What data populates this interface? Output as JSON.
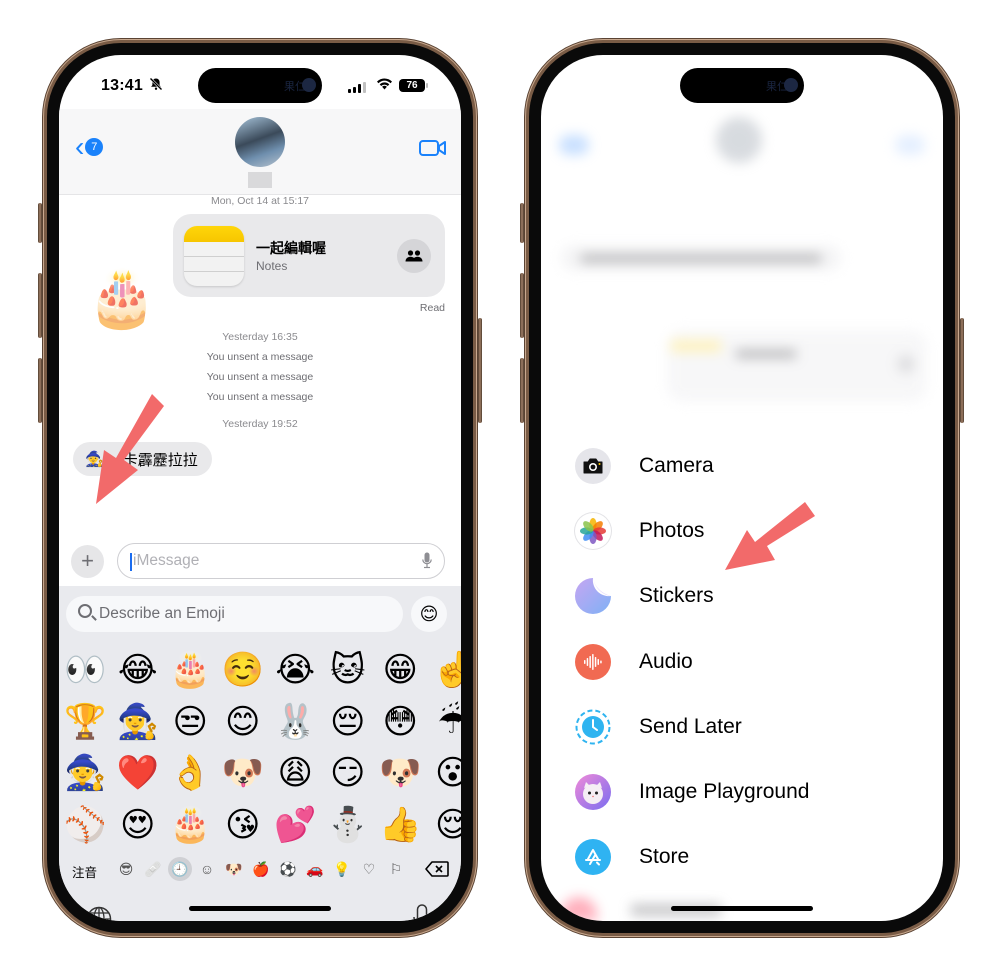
{
  "left_phone": {
    "status_bar": {
      "time": "13:41",
      "silent_icon": "bell-slash-icon",
      "battery": "76",
      "island_text": "果仁"
    },
    "nav": {
      "back_badge": "7",
      "contact_avatar": "contact-photo",
      "video_icon": "video-camera-icon"
    },
    "chat": {
      "timestamp_top": "Mon, Oct 14 at 15:17",
      "notes_card": {
        "title": "一起編輯喔",
        "subtitle": "Notes"
      },
      "read_receipt": "Read",
      "sticker": "🎂",
      "timestamp_2": "Yesterday 16:35",
      "system_messages": [
        "You unsent a message",
        "You unsent a message",
        "You unsent a message"
      ],
      "timestamp_3": "Yesterday 19:52",
      "received_message": {
        "emoji": "🧙",
        "text": "…卡霹靂拉拉"
      }
    },
    "input": {
      "plus_label": "+",
      "placeholder": "iMessage"
    },
    "keyboard": {
      "search_placeholder": "Describe an Emoji",
      "genmoji_icon": "😊",
      "emoji_rows": [
        [
          "👀",
          "😂",
          "🎂",
          "☺️",
          "😭",
          "🐱",
          "😁",
          "☝️"
        ],
        [
          "🏆",
          "🧙‍♀️",
          "😒",
          "😊",
          "🐰",
          "😔",
          "😳",
          "☔"
        ],
        [
          "🧙",
          "❤️",
          "👌",
          "🐶",
          "😩",
          "😏",
          "🐶",
          "😮"
        ],
        [
          "⚾",
          "😍",
          "🎂",
          "😘",
          "💕",
          "⛄",
          "👍",
          "😌"
        ]
      ],
      "category_label": "注音",
      "categories": [
        "😎",
        "🩹",
        "🕘",
        "☺",
        "🐶",
        "🍎",
        "⚽",
        "🚗",
        "💡",
        "♡",
        "⚐"
      ]
    }
  },
  "right_phone": {
    "status_bar": {
      "island_text": "果仁"
    },
    "menu": [
      {
        "label": "Camera",
        "icon": "camera-icon",
        "color": "#e5e5ea"
      },
      {
        "label": "Photos",
        "icon": "photos-icon",
        "color": "#ffffff"
      },
      {
        "label": "Stickers",
        "icon": "stickers-icon",
        "color": "#a9b6f5"
      },
      {
        "label": "Audio",
        "icon": "audio-waveform-icon",
        "color": "#f16a52"
      },
      {
        "label": "Send Later",
        "icon": "clock-icon",
        "color": "#2fb4f0"
      },
      {
        "label": "Image Playground",
        "icon": "image-playground-icon",
        "color": "#c2a3ef"
      },
      {
        "label": "Store",
        "icon": "app-store-icon",
        "color": "#2fb3f2"
      }
    ]
  },
  "annotations": {
    "arrow_color": "#f26a6a"
  }
}
